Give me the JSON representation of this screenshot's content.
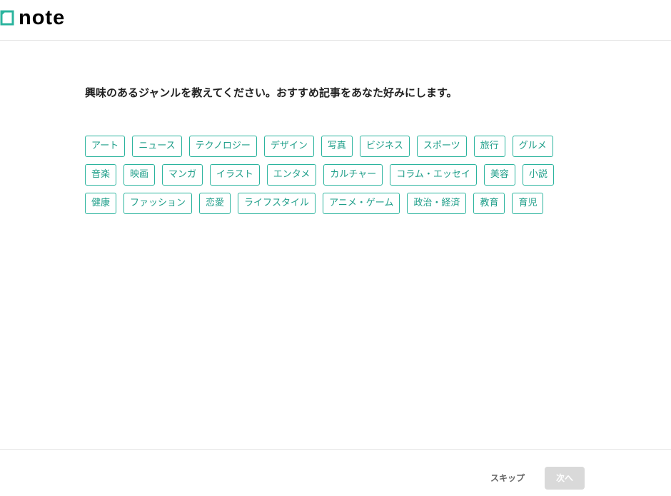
{
  "brand": {
    "name": "note",
    "accent": "#2bb49e"
  },
  "prompt": "興味のあるジャンルを教えてください。おすすめ記事をあなた好みにします。",
  "genres": [
    "アート",
    "ニュース",
    "テクノロジー",
    "デザイン",
    "写真",
    "ビジネス",
    "スポーツ",
    "旅行",
    "グルメ",
    "音楽",
    "映画",
    "マンガ",
    "イラスト",
    "エンタメ",
    "カルチャー",
    "コラム・エッセイ",
    "美容",
    "小説",
    "健康",
    "ファッション",
    "恋愛",
    "ライフスタイル",
    "アニメ・ゲーム",
    "政治・経済",
    "教育",
    "育児"
  ],
  "footer": {
    "skip_label": "スキップ",
    "next_label": "次へ",
    "next_disabled_color": "#d9d9d9"
  }
}
